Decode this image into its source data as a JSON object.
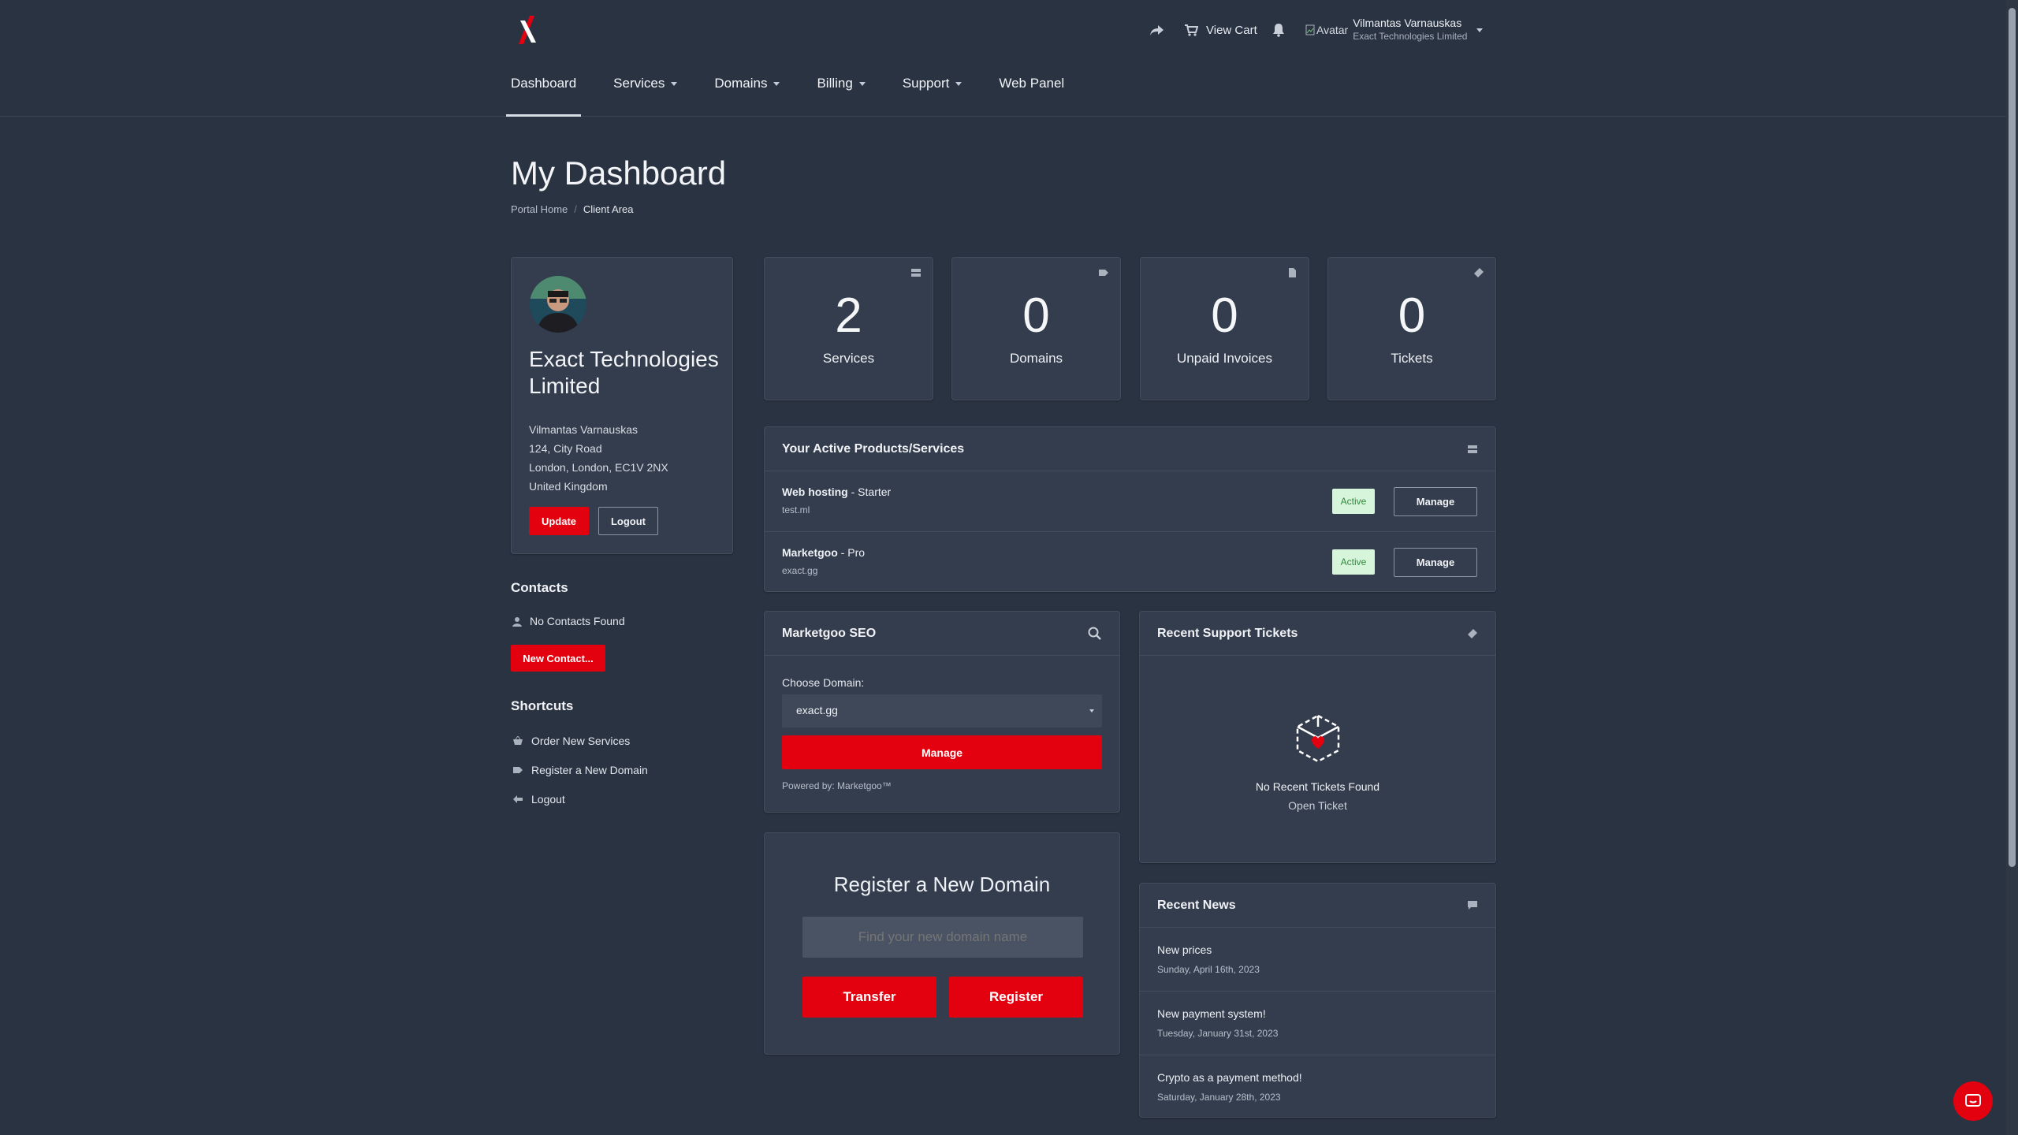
{
  "header": {
    "view_cart": "View Cart",
    "avatar_alt": "Avatar",
    "user_name": "Vilmantas Varnauskas",
    "company": "Exact Technologies Limited"
  },
  "nav": {
    "items": [
      "Dashboard",
      "Services",
      "Domains",
      "Billing",
      "Support",
      "Web Panel"
    ]
  },
  "page": {
    "title": "My Dashboard",
    "breadcrumb": [
      "Portal Home",
      "Client Area"
    ]
  },
  "profile": {
    "company": "Exact Technologies Limited",
    "name": "Vilmantas Varnauskas",
    "address1": "124, City Road",
    "address2": "London, London, EC1V 2NX",
    "country": "United Kingdom",
    "update": "Update",
    "logout": "Logout"
  },
  "contacts": {
    "title": "Contacts",
    "empty": "No Contacts Found",
    "new": "New Contact..."
  },
  "shortcuts": {
    "title": "Shortcuts",
    "items": [
      "Order New Services",
      "Register a New Domain",
      "Logout"
    ]
  },
  "stats": [
    {
      "value": "2",
      "label": "Services"
    },
    {
      "value": "0",
      "label": "Domains"
    },
    {
      "value": "0",
      "label": "Unpaid Invoices"
    },
    {
      "value": "0",
      "label": "Tickets"
    }
  ],
  "products": {
    "title": "Your Active Products/Services",
    "rows": [
      {
        "name": "Web hosting",
        "plan": " - Starter",
        "domain": "test.ml",
        "status": "Active",
        "action": "Manage"
      },
      {
        "name": "Marketgoo",
        "plan": " - Pro",
        "domain": "exact.gg",
        "status": "Active",
        "action": "Manage"
      }
    ]
  },
  "seo": {
    "title": "Marketgoo SEO",
    "choose": "Choose Domain:",
    "selected": "exact.gg",
    "manage": "Manage",
    "powered": "Powered by: Marketgoo™"
  },
  "tickets": {
    "title": "Recent Support Tickets",
    "empty": "No Recent Tickets Found",
    "open": "Open Ticket"
  },
  "register": {
    "title": "Register a New Domain",
    "placeholder": "Find your new domain name",
    "transfer": "Transfer",
    "register": "Register"
  },
  "news": {
    "title": "Recent News",
    "items": [
      {
        "title": "New prices",
        "date": "Sunday, April 16th, 2023"
      },
      {
        "title": "New payment system!",
        "date": "Tuesday, January 31st, 2023"
      },
      {
        "title": "Crypto as a payment method!",
        "date": "Saturday, January 28th, 2023"
      }
    ]
  },
  "colors": {
    "brand_red": "#e3000f",
    "bg": "#2a3342",
    "card": "#343d4d",
    "active_badge": "#d6f5da"
  }
}
